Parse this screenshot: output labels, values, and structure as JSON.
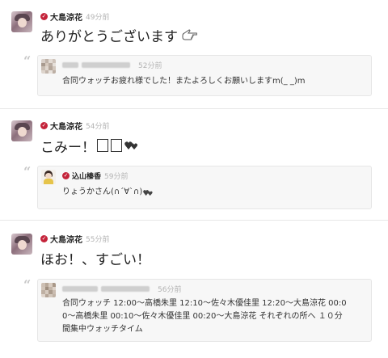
{
  "posts": [
    {
      "author": "大島涼花",
      "time": "49分前",
      "text": "ありがとうございます",
      "reply": {
        "time": "52分前",
        "text": "合同ウォッチお疲れ様でした！またよろしくお願いしますm(_ _)m"
      }
    },
    {
      "author": "大島涼花",
      "time": "54分前",
      "text": "こみー！",
      "reply": {
        "author": "込山榛香",
        "time": "59分前",
        "text": "りょうかさん(∩´∀`∩)"
      }
    },
    {
      "author": "大島涼花",
      "time": "55分前",
      "text": "ほお！、すごい！",
      "reply": {
        "time": "56分前",
        "text_lines": [
          "合同ウォッチ 12:00～高橋朱里 12:10～佐々木優佳里 12:20～大島涼花 00:0",
          "0～高橋朱里 00:10～佐々木優佳里 00:20～大島涼花 それぞれの所へ １０分",
          "間集中ウォッチタイム"
        ]
      }
    }
  ],
  "icons": {
    "verified_badge": "check-badge-icon",
    "quote": "quote-icon",
    "hand": "pointing-hand-icon",
    "hearts": "hearts-icon"
  },
  "colors": {
    "badge": "#c4233a",
    "time": "#b3b3b3",
    "reply_bg": "#f7f7f7",
    "divider": "#e8e8e8"
  }
}
